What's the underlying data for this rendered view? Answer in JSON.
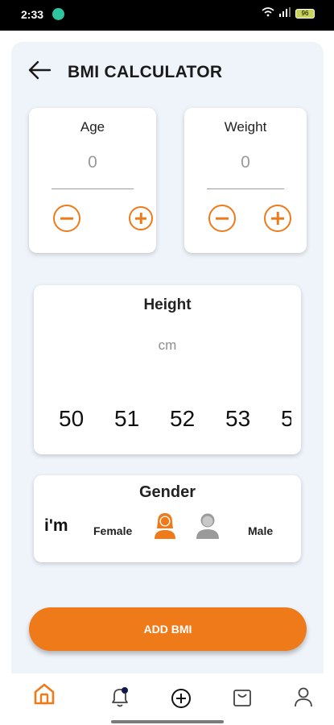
{
  "status": {
    "time": "2:33",
    "battery": "96"
  },
  "header": {
    "title": "BMI CALCULATOR"
  },
  "age": {
    "label": "Age",
    "value": "0"
  },
  "weight": {
    "label": "Weight",
    "value": "0"
  },
  "height": {
    "label": "Height",
    "unit": "cm",
    "ruler": [
      "50",
      "51",
      "52",
      "53",
      "5"
    ]
  },
  "gender": {
    "label": "Gender",
    "prefix": "i'm",
    "female": "Female",
    "male": "Male",
    "selected": "female"
  },
  "actions": {
    "add_label": "ADD BMI"
  },
  "colors": {
    "accent": "#ee7a1a",
    "background": "#eff4fa",
    "inactive": "#9a9a9a"
  },
  "nav": {
    "items": [
      {
        "name": "home",
        "icon": "home-icon",
        "active": true
      },
      {
        "name": "notifications",
        "icon": "bell-icon",
        "badge": true
      },
      {
        "name": "add",
        "icon": "plus-circle-icon"
      },
      {
        "name": "cart",
        "icon": "shopping-bag-icon"
      },
      {
        "name": "profile",
        "icon": "user-icon"
      }
    ]
  }
}
